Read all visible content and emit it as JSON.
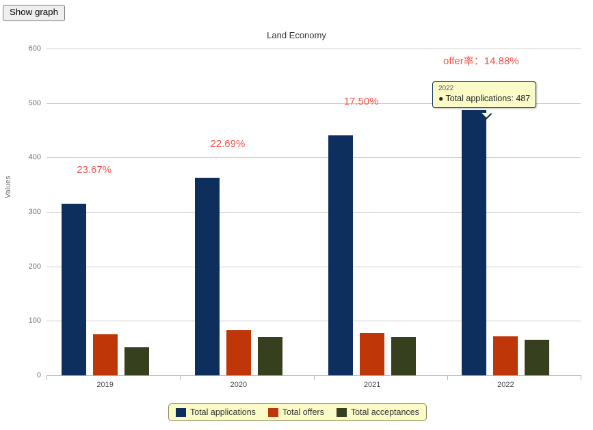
{
  "toolbar": {
    "show_graph_label": "Show graph"
  },
  "chart_data": {
    "type": "bar",
    "title": "Land Economy",
    "xlabel": "",
    "ylabel": "Values",
    "ylim": [
      0,
      600
    ],
    "yticks": [
      600,
      500,
      400,
      300,
      200,
      100,
      0
    ],
    "grid": true,
    "legend_position": "bottom",
    "categories": [
      "2019",
      "2020",
      "2021",
      "2022"
    ],
    "series": [
      {
        "name": "Total applications",
        "color": "#0d2f5e",
        "values": [
          315,
          363,
          440,
          487
        ]
      },
      {
        "name": "Total offers",
        "color": "#bf3609",
        "values": [
          75,
          83,
          78,
          72
        ]
      },
      {
        "name": "Total acceptances",
        "color": "#36401f",
        "values": [
          51,
          70,
          70,
          65
        ]
      }
    ],
    "annotations": [
      {
        "text": "23.67%",
        "category": "2019"
      },
      {
        "text": "22.69%",
        "category": "2020"
      },
      {
        "text": "17.50%",
        "category": "2021"
      },
      {
        "text": "offer率：14.88%",
        "category": "2022"
      }
    ]
  },
  "tooltip": {
    "header": "2022",
    "bullet": "●",
    "row_label": "Total applications:",
    "row_value": "487"
  }
}
